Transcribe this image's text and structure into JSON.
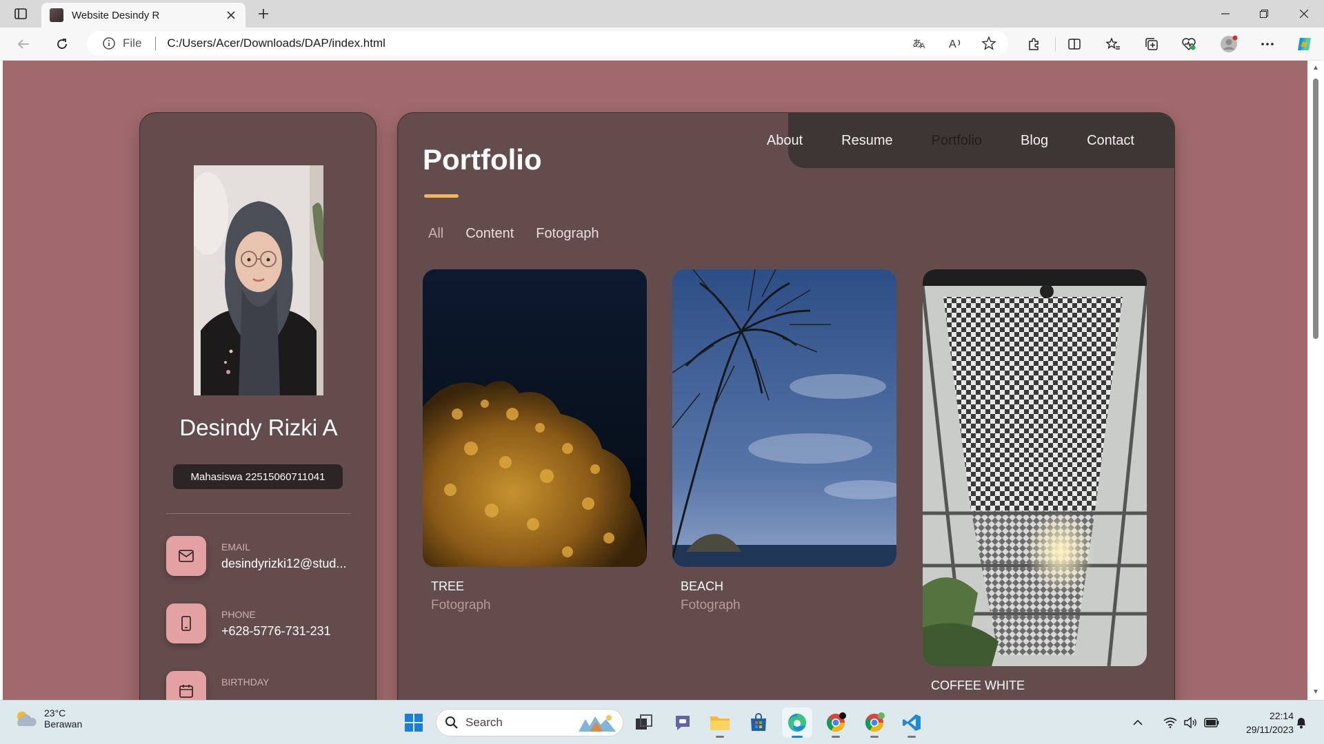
{
  "browser": {
    "tab_title": "Website Desindy R",
    "site_label": "File",
    "url": "C:/Users/Acer/Downloads/DAP/index.html"
  },
  "profile": {
    "name": "Desindy Rizki A",
    "role": "Mahasiswa 22515060711041",
    "contacts": [
      {
        "label": "EMAIL",
        "value": "desindyrizki12@stud...",
        "icon": "mail-icon"
      },
      {
        "label": "PHONE",
        "value": "+628-5776-731-231",
        "icon": "phone-icon"
      },
      {
        "label": "BIRTHDAY",
        "value": "",
        "icon": "calendar-icon"
      }
    ]
  },
  "nav": {
    "items": [
      "About",
      "Resume",
      "Portfolio",
      "Blog",
      "Contact"
    ],
    "active": "Portfolio"
  },
  "portfolio": {
    "title": "Portfolio",
    "filters": [
      "All",
      "Content",
      "Fotograph"
    ],
    "active_filter": "All",
    "projects": [
      {
        "title": "TREE",
        "category": "Fotograph"
      },
      {
        "title": "BEACH",
        "category": "Fotograph"
      },
      {
        "title": "COFFEE WHITE",
        "category": ""
      }
    ]
  },
  "colors": {
    "page_bg": "#a06a6c",
    "card_bg": "#644c4d",
    "nav_bg": "#3e3535",
    "accent": "#f4b35d",
    "icon_box": "#e3a1a3"
  },
  "taskbar": {
    "temperature": "23°C",
    "weather": "Berawan",
    "search_placeholder": "Search",
    "time": "22:14",
    "date": "29/11/2023"
  }
}
